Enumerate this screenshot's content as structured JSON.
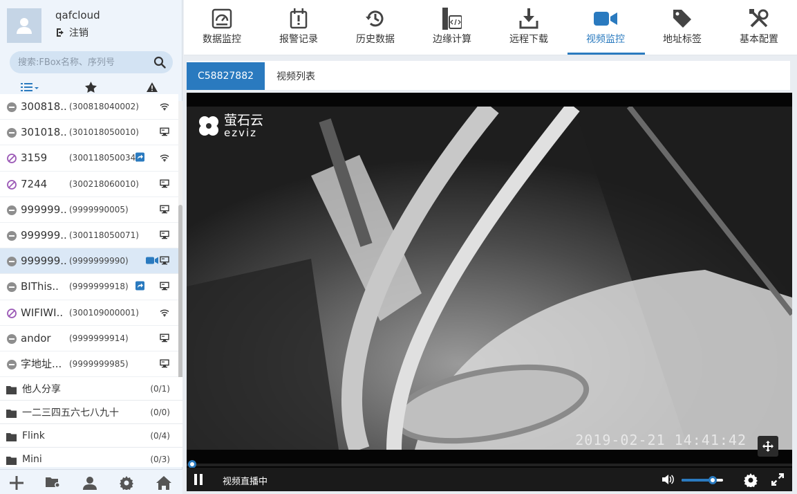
{
  "user": {
    "name": "qafcloud",
    "logout_label": "注销"
  },
  "search": {
    "placeholder": "搜索:FBox名称、序列号"
  },
  "filters": [
    "list-icon",
    "star-icon",
    "warning-icon"
  ],
  "devices": [
    {
      "name": "300818..",
      "serial": "(300818040002)",
      "status": "offline",
      "net": "wifi",
      "shared": false,
      "camera": false
    },
    {
      "name": "301018..",
      "serial": "(301018050010)",
      "status": "offline",
      "net": "ethernet",
      "shared": false,
      "camera": false
    },
    {
      "name": "3159",
      "serial": "(300118050034)",
      "status": "disabled",
      "net": "wifi",
      "shared": true,
      "camera": false
    },
    {
      "name": "7244",
      "serial": "(300218060010)",
      "status": "disabled",
      "net": "ethernet",
      "shared": false,
      "camera": false
    },
    {
      "name": "999999..",
      "serial": "(9999990005)",
      "status": "offline",
      "net": "ethernet",
      "shared": false,
      "camera": false
    },
    {
      "name": "999999..",
      "serial": "(300118050071)",
      "status": "offline",
      "net": "ethernet",
      "shared": false,
      "camera": false
    },
    {
      "name": "999999..",
      "serial": "(9999999990)",
      "status": "offline",
      "net": "ethernet",
      "shared": false,
      "camera": true,
      "selected": true
    },
    {
      "name": "BIThis..",
      "serial": "(9999999918)",
      "status": "offline",
      "net": "ethernet",
      "shared": true,
      "camera": false
    },
    {
      "name": "WIFIWI..",
      "serial": "(300109000001)",
      "status": "disabled",
      "net": "wifi",
      "shared": false,
      "camera": false
    },
    {
      "name": "andor",
      "serial": "(9999999914)",
      "status": "offline",
      "net": "ethernet",
      "shared": false,
      "camera": false
    },
    {
      "name": "字地址...",
      "serial": "(9999999985)",
      "status": "offline",
      "net": "ethernet",
      "shared": false,
      "camera": false
    }
  ],
  "groups": [
    {
      "name": "他人分享",
      "count": "(0/1)"
    },
    {
      "name": "一二三四五六七八九十",
      "count": "(0/0)"
    },
    {
      "name": "Flink",
      "count": "(0/4)"
    },
    {
      "name": "Mini",
      "count": "(0/3)"
    }
  ],
  "nav": [
    {
      "label": "数据监控",
      "icon": "gauge-icon"
    },
    {
      "label": "报警记录",
      "icon": "alarm-icon"
    },
    {
      "label": "历史数据",
      "icon": "history-icon"
    },
    {
      "label": "边缘计算",
      "icon": "code-icon"
    },
    {
      "label": "远程下载",
      "icon": "download-icon"
    },
    {
      "label": "视频监控",
      "icon": "video-icon",
      "active": true
    },
    {
      "label": "地址标签",
      "icon": "tag-icon"
    },
    {
      "label": "基本配置",
      "icon": "tools-icon"
    }
  ],
  "tabs": [
    {
      "label": "C58827882",
      "active": true
    },
    {
      "label": "视频列表",
      "active": false
    }
  ],
  "video": {
    "logo_cn": "萤石云",
    "logo_en": "ezviz",
    "timestamp": "2019-02-21 14:41:42",
    "status": "视频直播中",
    "volume": 0.75
  },
  "colors": {
    "accent": "#2a7abf",
    "sidebar_bg": "#eef4fb",
    "selected_row": "#dbe8f6"
  }
}
